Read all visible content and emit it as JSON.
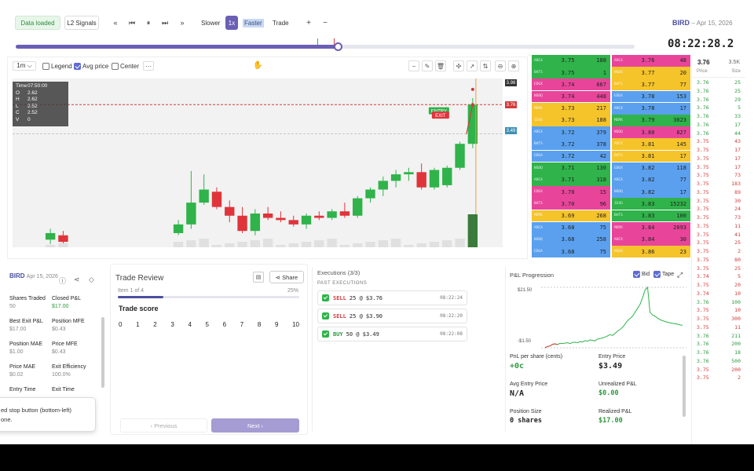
{
  "topbar": {
    "data_loaded": "Data loaded",
    "l2_signals": "L2 Signals",
    "controls": [
      "«",
      "⏮",
      "⏸",
      "⏭",
      "»"
    ],
    "slower": "Slower",
    "speed": "1x",
    "faster": "Faster",
    "trade": "Trade",
    "plus": "+",
    "minus": "−",
    "symbol": "BIRD",
    "date": "– Apr 15, 2026",
    "clock": "08:22:28.2",
    "progress": 0.52
  },
  "chart": {
    "interval": "1m ⌵",
    "legend": "Legend",
    "avg_price": "Avg price",
    "center": "Center",
    "more": "···",
    "ohlc": {
      "time_label": "Time",
      "time": "07:50:00",
      "o_label": "O",
      "o": "2.62",
      "h_label": "H",
      "h": "2.62",
      "l_label": "L",
      "l": "2.52",
      "c_label": "C",
      "c": "2.52",
      "v_label": "V",
      "v": "0"
    },
    "tags": {
      "top": "3.98",
      "red": "3.76",
      "blue": "3.49"
    },
    "entry_label": "ENTRY",
    "exit_label": "EXIT"
  },
  "chart_data": {
    "type": "candlestick",
    "ylim": [
      2.45,
      4.0
    ],
    "candles": [
      {
        "o": 2.52,
        "h": 2.62,
        "l": 2.48,
        "c": 2.58
      },
      {
        "o": 2.56,
        "h": 2.6,
        "l": 2.46,
        "c": 2.5
      },
      {
        "o": 2.58,
        "h": 2.7,
        "l": 2.56,
        "c": 2.66
      },
      {
        "o": 2.66,
        "h": 3.15,
        "l": 2.62,
        "c": 2.86
      },
      {
        "o": 2.86,
        "h": 3.12,
        "l": 2.84,
        "c": 2.98
      },
      {
        "o": 2.96,
        "h": 3.0,
        "l": 2.8,
        "c": 2.82
      },
      {
        "o": 2.82,
        "h": 2.88,
        "l": 2.68,
        "c": 2.74
      },
      {
        "o": 2.74,
        "h": 2.82,
        "l": 2.58,
        "c": 2.6
      },
      {
        "o": 2.6,
        "h": 2.8,
        "l": 2.56,
        "c": 2.76
      },
      {
        "o": 2.76,
        "h": 2.82,
        "l": 2.7,
        "c": 2.72
      },
      {
        "o": 2.72,
        "h": 2.78,
        "l": 2.68,
        "c": 2.7
      },
      {
        "o": 2.7,
        "h": 2.74,
        "l": 2.64,
        "c": 2.66
      },
      {
        "o": 2.66,
        "h": 2.76,
        "l": 2.62,
        "c": 2.74
      },
      {
        "o": 2.74,
        "h": 2.78,
        "l": 2.7,
        "c": 2.72
      },
      {
        "o": 2.72,
        "h": 2.8,
        "l": 2.7,
        "c": 2.78
      },
      {
        "o": 2.78,
        "h": 2.86,
        "l": 2.72,
        "c": 2.74
      },
      {
        "o": 2.74,
        "h": 2.92,
        "l": 2.72,
        "c": 2.9
      },
      {
        "o": 2.9,
        "h": 3.0,
        "l": 2.86,
        "c": 2.98
      },
      {
        "o": 2.98,
        "h": 3.1,
        "l": 2.92,
        "c": 3.06
      },
      {
        "o": 3.06,
        "h": 3.16,
        "l": 3.0,
        "c": 3.12
      },
      {
        "o": 3.12,
        "h": 3.18,
        "l": 3.06,
        "c": 3.14
      },
      {
        "o": 3.14,
        "h": 3.22,
        "l": 2.98,
        "c": 3.0
      },
      {
        "o": 3.0,
        "h": 3.18,
        "l": 2.98,
        "c": 3.16
      },
      {
        "o": 3.02,
        "h": 3.2,
        "l": 3.0,
        "c": 3.18
      },
      {
        "o": 3.18,
        "h": 3.42,
        "l": 3.16,
        "c": 3.4
      },
      {
        "o": 3.4,
        "h": 3.82,
        "l": 3.36,
        "c": 3.76
      }
    ]
  },
  "orderbook": {
    "bids": [
      {
        "ex": "ARCX",
        "p": "3.75",
        "s": "188",
        "c": "#2fb34a"
      },
      {
        "ex": "BATS",
        "p": "3.75",
        "s": "1",
        "c": "#2fb34a"
      },
      {
        "ex": "EDGX",
        "p": "3.74",
        "s": "667",
        "c": "#e8459a"
      },
      {
        "ex": "NSDQ",
        "p": "3.74",
        "s": "448",
        "c": "#e8459a"
      },
      {
        "ex": "MEMX",
        "p": "3.73",
        "s": "217",
        "c": "#f5c32a"
      },
      {
        "ex": "IEXG",
        "p": "3.73",
        "s": "188",
        "c": "#f5c32a"
      },
      {
        "ex": "ARCX",
        "p": "3.72",
        "s": "379",
        "c": "#5aa0ee"
      },
      {
        "ex": "BATS",
        "p": "3.72",
        "s": "378",
        "c": "#5aa0ee"
      },
      {
        "ex": "EDGA",
        "p": "3.72",
        "s": "42",
        "c": "#5aa0ee"
      },
      {
        "ex": "NSDQ",
        "p": "3.71",
        "s": "130",
        "c": "#2fb34a"
      },
      {
        "ex": "ARCX",
        "p": "3.71",
        "s": "318",
        "c": "#2fb34a"
      },
      {
        "ex": "EDGX",
        "p": "3.70",
        "s": "15",
        "c": "#e8459a"
      },
      {
        "ex": "BATS",
        "p": "3.70",
        "s": "96",
        "c": "#e8459a"
      },
      {
        "ex": "MEMX",
        "p": "3.69",
        "s": "268",
        "c": "#f5c32a"
      },
      {
        "ex": "ARCX",
        "p": "3.68",
        "s": "75",
        "c": "#5aa0ee"
      },
      {
        "ex": "NSDQ",
        "p": "3.68",
        "s": "258",
        "c": "#5aa0ee"
      },
      {
        "ex": "EDGA",
        "p": "3.68",
        "s": "75",
        "c": "#5aa0ee"
      }
    ],
    "asks": [
      {
        "ex": "ARCX",
        "p": "3.76",
        "s": "48",
        "c": "#e8459a"
      },
      {
        "ex": "NSDQ",
        "p": "3.77",
        "s": "20",
        "c": "#f5c32a"
      },
      {
        "ex": "BATS",
        "p": "3.77",
        "s": "77",
        "c": "#f5c32a"
      },
      {
        "ex": "EDGX",
        "p": "3.78",
        "s": "153",
        "c": "#5aa0ee"
      },
      {
        "ex": "ARCX",
        "p": "3.78",
        "s": "17",
        "c": "#5aa0ee"
      },
      {
        "ex": "MEMX",
        "p": "3.79",
        "s": "3023",
        "c": "#2fb34a"
      },
      {
        "ex": "NSDQ",
        "p": "3.80",
        "s": "827",
        "c": "#e8459a"
      },
      {
        "ex": "ARCX",
        "p": "3.81",
        "s": "145",
        "c": "#f5c32a"
      },
      {
        "ex": "BATS",
        "p": "3.81",
        "s": "17",
        "c": "#f5c32a"
      },
      {
        "ex": "EDGX",
        "p": "3.82",
        "s": "118",
        "c": "#5aa0ee"
      },
      {
        "ex": "ARCX",
        "p": "3.82",
        "s": "77",
        "c": "#5aa0ee"
      },
      {
        "ex": "NSDQ",
        "p": "3.82",
        "s": "17",
        "c": "#5aa0ee"
      },
      {
        "ex": "IEXG",
        "p": "3.83",
        "s": "15232",
        "c": "#2fb34a"
      },
      {
        "ex": "BATS",
        "p": "3.83",
        "s": "100",
        "c": "#2fb34a"
      },
      {
        "ex": "MEMX",
        "p": "3.84",
        "s": "2093",
        "c": "#e8459a"
      },
      {
        "ex": "ARCX",
        "p": "3.84",
        "s": "30",
        "c": "#e8459a"
      },
      {
        "ex": "NSDQ",
        "p": "3.86",
        "s": "23",
        "c": "#f5c32a"
      }
    ]
  },
  "tape": {
    "price": "3.76",
    "volume": "3.5K",
    "col_price": "Price",
    "col_size": "Size",
    "rows": [
      {
        "p": "3.76",
        "s": "25",
        "c": "g"
      },
      {
        "p": "3.76",
        "s": "25",
        "c": "g"
      },
      {
        "p": "3.76",
        "s": "29",
        "c": "g"
      },
      {
        "p": "3.76",
        "s": "5",
        "c": "g"
      },
      {
        "p": "3.76",
        "s": "33",
        "c": "g"
      },
      {
        "p": "3.76",
        "s": "17",
        "c": "g"
      },
      {
        "p": "3.76",
        "s": "44",
        "c": "g"
      },
      {
        "p": "3.75",
        "s": "43",
        "c": "r"
      },
      {
        "p": "3.75",
        "s": "17",
        "c": "r"
      },
      {
        "p": "3.75",
        "s": "17",
        "c": "r"
      },
      {
        "p": "3.75",
        "s": "17",
        "c": "r"
      },
      {
        "p": "3.75",
        "s": "73",
        "c": "r"
      },
      {
        "p": "3.75",
        "s": "183",
        "c": "r"
      },
      {
        "p": "3.75",
        "s": "89",
        "c": "r"
      },
      {
        "p": "3.75",
        "s": "30",
        "c": "r"
      },
      {
        "p": "3.75",
        "s": "24",
        "c": "r"
      },
      {
        "p": "3.75",
        "s": "73",
        "c": "r"
      },
      {
        "p": "3.75",
        "s": "11",
        "c": "r"
      },
      {
        "p": "3.75",
        "s": "41",
        "c": "r"
      },
      {
        "p": "3.75",
        "s": "25",
        "c": "r"
      },
      {
        "p": "3.75",
        "s": "2",
        "c": "r"
      },
      {
        "p": "3.75",
        "s": "80",
        "c": "r"
      },
      {
        "p": "3.75",
        "s": "25",
        "c": "r"
      },
      {
        "p": "3.74",
        "s": "5",
        "c": "r"
      },
      {
        "p": "3.75",
        "s": "20",
        "c": "r"
      },
      {
        "p": "3.74",
        "s": "10",
        "c": "r"
      },
      {
        "p": "3.76",
        "s": "100",
        "c": "g"
      },
      {
        "p": "3.75",
        "s": "10",
        "c": "r"
      },
      {
        "p": "3.75",
        "s": "300",
        "c": "r"
      },
      {
        "p": "3.75",
        "s": "11",
        "c": "r"
      },
      {
        "p": "3.76",
        "s": "211",
        "c": "g"
      },
      {
        "p": "3.76",
        "s": "200",
        "c": "g"
      },
      {
        "p": "3.76",
        "s": "18",
        "c": "g"
      },
      {
        "p": "3.76",
        "s": "500",
        "c": "g"
      },
      {
        "p": "3.75",
        "s": "200",
        "c": "r"
      },
      {
        "p": "3.75",
        "s": "2",
        "c": "r"
      }
    ]
  },
  "summary": {
    "symbol": "BIRD",
    "date": "Apr 15, 2026",
    "fields": [
      {
        "label": "Shares Traded",
        "value": "50",
        "green": false
      },
      {
        "label": "Closed P&L",
        "value": "$17.00",
        "green": true
      },
      {
        "label": "Best Exit P&L",
        "value": "$17.00",
        "green": false
      },
      {
        "label": "Position MFE",
        "value": "$0.43",
        "green": false
      },
      {
        "label": "Position MAE",
        "value": "$1.00",
        "green": false
      },
      {
        "label": "Price MFE",
        "value": "$0.43",
        "green": false
      },
      {
        "label": "Price MAE",
        "value": "$0.02",
        "green": false
      },
      {
        "label": "Exit Efficiency",
        "value": "100.0%",
        "green": false
      },
      {
        "label": "Entry Time",
        "value": "",
        "green": false
      },
      {
        "label": "Exit Time",
        "value": "",
        "green": false
      }
    ],
    "toast_line1": "ed stop button (bottom-left)",
    "toast_line2": "one."
  },
  "review": {
    "title": "Trade Review",
    "share": "Share",
    "item": "Item 1 of 4",
    "pct": "25%",
    "progress": 0.25,
    "score_title": "Trade score",
    "scale": [
      "0",
      "1",
      "2",
      "3",
      "4",
      "5",
      "6",
      "7",
      "8",
      "9",
      "10"
    ],
    "prev": "‹   Previous",
    "next": "Next   ›"
  },
  "executions": {
    "title": "Executions (3/3)",
    "subtitle": "PAST EXECUTIONS",
    "items": [
      {
        "side": "SELL",
        "detail": "25 @ $3.76",
        "time": "08:22:24",
        "kind": "sell"
      },
      {
        "side": "SELL",
        "detail": "25 @ $3.90",
        "time": "08:22:20",
        "kind": "sell"
      },
      {
        "side": "BUY",
        "detail": "50 @ $3.49",
        "time": "08:22:08",
        "kind": "buy"
      }
    ]
  },
  "pnl": {
    "title": "P&L Progression",
    "bid": "Bid",
    "tape": "Tape",
    "ymax": "$21.50",
    "ymin": "-$1.50",
    "series": [
      -1.5,
      -1.0,
      -0.8,
      -0.2,
      0.0,
      -0.3,
      0.2,
      0.1,
      0.3,
      0.4,
      0.1,
      0.5,
      0.6,
      0.4,
      0.8,
      0.7,
      1.2,
      1.0,
      1.5,
      1.3,
      1.1,
      1.8,
      2.0,
      2.2,
      2.6,
      3.0,
      3.5,
      3.2,
      4.0,
      4.8,
      5.5,
      6.2,
      7.5,
      8.8,
      9.6,
      10.5,
      12.0,
      13.5,
      15.0,
      17.5,
      20.5,
      21.5,
      12.0,
      11.0,
      10.5,
      9.8,
      9.2,
      8.8,
      8.5,
      8.2,
      8.0,
      7.8,
      7.6,
      7.5,
      7.2,
      7.0
    ],
    "fields": [
      {
        "label": "PnL per share (cents)",
        "value": "+0c",
        "cls": "g"
      },
      {
        "label": "Entry Price",
        "value": "$3.49",
        "cls": ""
      },
      {
        "label": "Avg Entry Price",
        "value": "N/A",
        "cls": ""
      },
      {
        "label": "Unrealized P&L",
        "value": "$0.00",
        "cls": "g s"
      },
      {
        "label": "Position Size",
        "value": "0 shares",
        "cls": "s"
      },
      {
        "label": "Realized P&L",
        "value": "$17.00",
        "cls": "g s"
      }
    ]
  }
}
